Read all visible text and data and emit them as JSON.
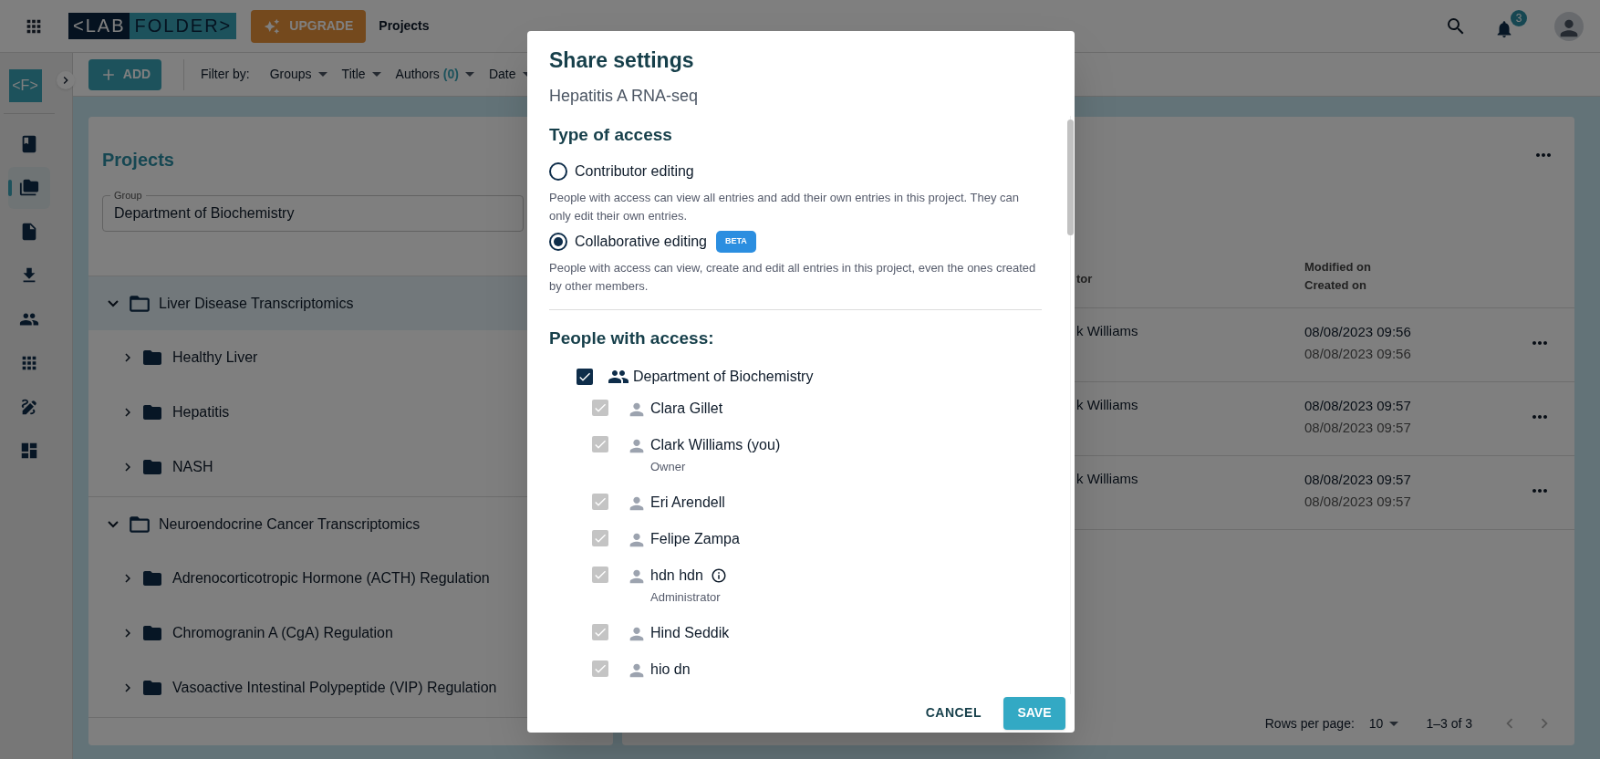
{
  "topbar": {
    "logo_left": "<LAB",
    "logo_right": "FOLDER>",
    "upgrade": "UPGRADE",
    "page_title": "Projects",
    "notification_count": "3"
  },
  "toolbar": {
    "add": "ADD",
    "filter_label": "Filter by:",
    "filters": [
      {
        "label": "Groups"
      },
      {
        "label": "Title"
      },
      {
        "label": "Authors",
        "count": "(0)"
      },
      {
        "label": "Date"
      }
    ]
  },
  "rail": {
    "logo": "<F>",
    "items": [
      {
        "kind": "book",
        "selected": false
      },
      {
        "kind": "folders",
        "selected": true
      },
      {
        "kind": "template",
        "selected": false
      },
      {
        "kind": "download",
        "selected": false
      },
      {
        "kind": "people",
        "selected": false
      },
      {
        "kind": "apps",
        "selected": false
      },
      {
        "kind": "signature",
        "selected": false
      },
      {
        "kind": "dashboard",
        "selected": false
      }
    ]
  },
  "projects_panel": {
    "title": "Projects",
    "group_field": {
      "label": "Group",
      "value": "Department of Biochemistry"
    },
    "tree": [
      {
        "label": "Liver Disease Transcriptomics",
        "expanded": true,
        "selected": true,
        "children": [
          {
            "label": "Healthy Liver",
            "expanded": false
          },
          {
            "label": "Hepatitis",
            "expanded": false
          },
          {
            "label": "NASH",
            "expanded": false
          }
        ]
      },
      {
        "label": "Neuroendocrine Cancer Transcriptomics",
        "expanded": true,
        "selected": false,
        "children": [
          {
            "label": "Adrenocorticotropic Hormone (ACTH) Regulation",
            "expanded": false
          },
          {
            "label": "Chromogranin A (CgA) Regulation",
            "expanded": false
          },
          {
            "label": "Vasoactive Intestinal Polypeptide (VIP) Regulation",
            "expanded": false
          }
        ]
      }
    ]
  },
  "entries_panel": {
    "columns": {
      "creator": "tor",
      "modified": "Modified on",
      "created": "Created on"
    },
    "rows": [
      {
        "creator": "k Williams",
        "modified": "08/08/2023 09:56",
        "created": "08/08/2023 09:56"
      },
      {
        "creator": "k Williams",
        "modified": "08/08/2023 09:57",
        "created": "08/08/2023 09:57"
      },
      {
        "creator": "k Williams",
        "modified": "08/08/2023 09:57",
        "created": "08/08/2023 09:57"
      }
    ],
    "pagination": {
      "rows_label": "Rows per page:",
      "rows_value": "10",
      "range": "1–3 of 3"
    }
  },
  "dialog": {
    "title": "Share settings",
    "subtitle": "Hepatitis A RNA-seq",
    "access_heading": "Type of access",
    "options": [
      {
        "label": "Contributor editing",
        "selected": false,
        "description": "People with access can view all entries and add their own entries in this project. They can only edit their own entries."
      },
      {
        "label": "Collaborative editing",
        "selected": true,
        "badge": "BETA",
        "description": "People with access can view, create and edit all entries in this project, even the ones created by other members."
      }
    ],
    "people_heading": "People with access:",
    "group": {
      "name": "Department of Biochemistry",
      "checked": true
    },
    "members": [
      {
        "name": "Clara Gillet",
        "checked": true,
        "disabled": true
      },
      {
        "name": "Clark Williams (you)",
        "role": "Owner",
        "checked": true,
        "disabled": true
      },
      {
        "name": "Eri Arendell",
        "checked": true,
        "disabled": true
      },
      {
        "name": "Felipe Zampa",
        "checked": true,
        "disabled": true
      },
      {
        "name": "hdn hdn",
        "role": "Administrator",
        "info": true,
        "checked": true,
        "disabled": true
      },
      {
        "name": "Hind Seddik",
        "checked": true,
        "disabled": true
      },
      {
        "name": "hio dn",
        "checked": true,
        "disabled": true
      }
    ],
    "cancel": "CANCEL",
    "save": "SAVE"
  }
}
